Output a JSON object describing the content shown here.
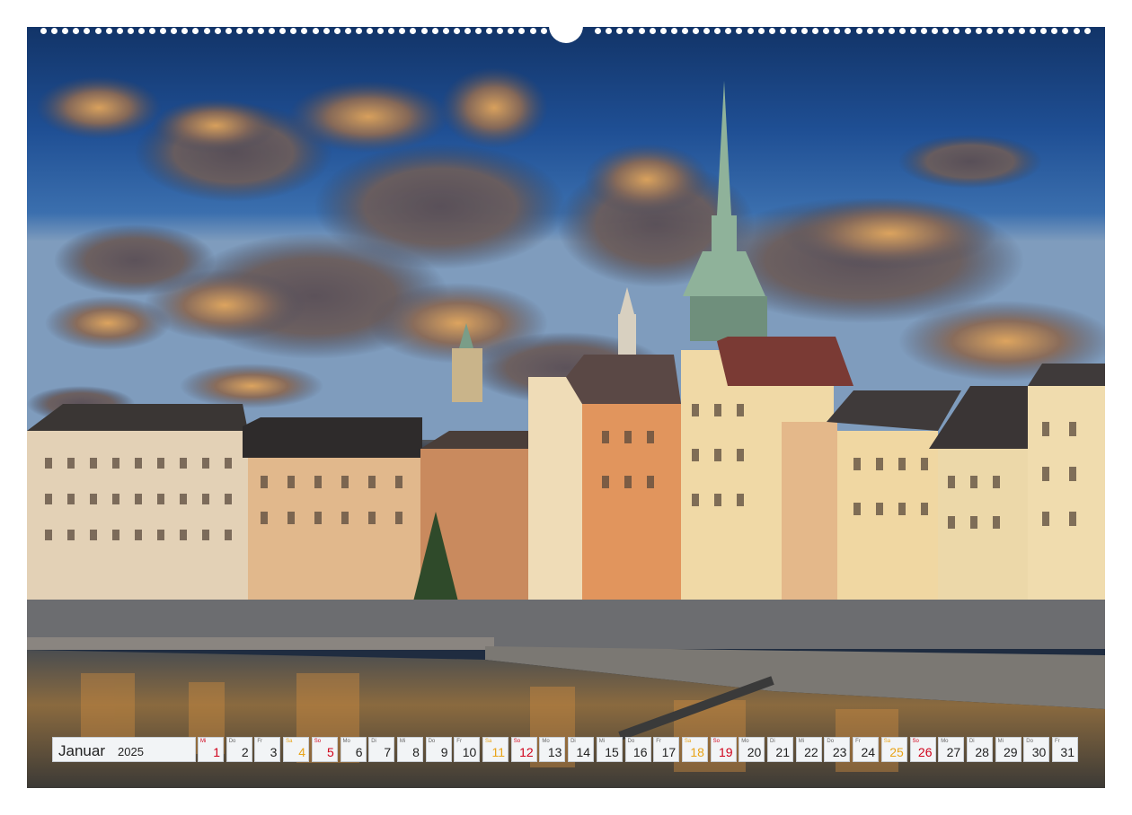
{
  "calendar": {
    "month": "Januar",
    "year": "2025",
    "days": [
      {
        "dow": "Mi",
        "num": "1",
        "type": "sun"
      },
      {
        "dow": "Do",
        "num": "2",
        "type": "wd"
      },
      {
        "dow": "Fr",
        "num": "3",
        "type": "wd"
      },
      {
        "dow": "Sa",
        "num": "4",
        "type": "sat"
      },
      {
        "dow": "So",
        "num": "5",
        "type": "sun"
      },
      {
        "dow": "Mo",
        "num": "6",
        "type": "wd"
      },
      {
        "dow": "Di",
        "num": "7",
        "type": "wd"
      },
      {
        "dow": "Mi",
        "num": "8",
        "type": "wd"
      },
      {
        "dow": "Do",
        "num": "9",
        "type": "wd"
      },
      {
        "dow": "Fr",
        "num": "10",
        "type": "wd"
      },
      {
        "dow": "Sa",
        "num": "11",
        "type": "sat"
      },
      {
        "dow": "So",
        "num": "12",
        "type": "sun"
      },
      {
        "dow": "Mo",
        "num": "13",
        "type": "wd"
      },
      {
        "dow": "Di",
        "num": "14",
        "type": "wd"
      },
      {
        "dow": "Mi",
        "num": "15",
        "type": "wd"
      },
      {
        "dow": "Do",
        "num": "16",
        "type": "wd"
      },
      {
        "dow": "Fr",
        "num": "17",
        "type": "wd"
      },
      {
        "dow": "Sa",
        "num": "18",
        "type": "sat"
      },
      {
        "dow": "So",
        "num": "19",
        "type": "sun"
      },
      {
        "dow": "Mo",
        "num": "20",
        "type": "wd"
      },
      {
        "dow": "Di",
        "num": "21",
        "type": "wd"
      },
      {
        "dow": "Mi",
        "num": "22",
        "type": "wd"
      },
      {
        "dow": "Do",
        "num": "23",
        "type": "wd"
      },
      {
        "dow": "Fr",
        "num": "24",
        "type": "wd"
      },
      {
        "dow": "Sa",
        "num": "25",
        "type": "sat"
      },
      {
        "dow": "So",
        "num": "26",
        "type": "sun"
      },
      {
        "dow": "Mo",
        "num": "27",
        "type": "wd"
      },
      {
        "dow": "Di",
        "num": "28",
        "type": "wd"
      },
      {
        "dow": "Mi",
        "num": "29",
        "type": "wd"
      },
      {
        "dow": "Do",
        "num": "30",
        "type": "wd"
      },
      {
        "dow": "Fr",
        "num": "31",
        "type": "wd"
      }
    ]
  },
  "colors": {
    "sunday": "#d0021b",
    "saturday": "#e8a317",
    "cell_bg": "#f2f4f6"
  }
}
